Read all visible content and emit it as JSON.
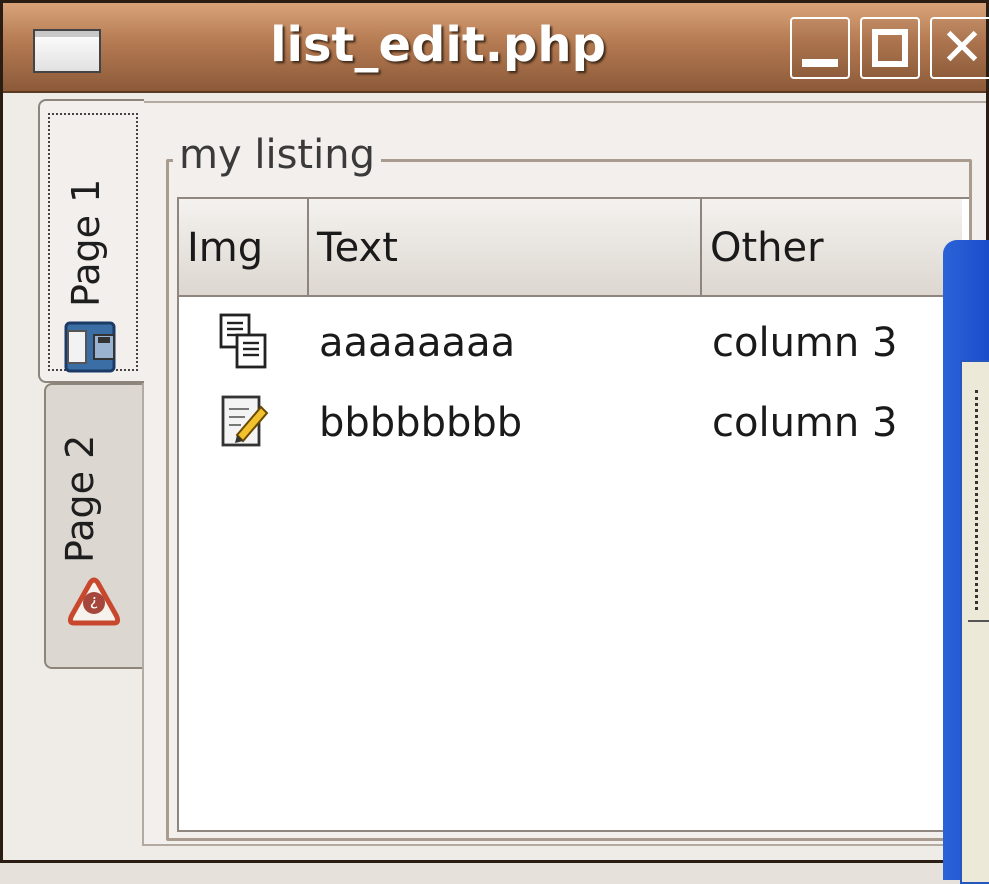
{
  "window": {
    "title": "list_edit.php",
    "colors": {
      "titlebar": "#b47a52",
      "overlap_window": "#1f55d0"
    }
  },
  "tabs": [
    {
      "label": "Page 1",
      "icon": "floppy-disk-icon",
      "selected": true
    },
    {
      "label": "Page 2",
      "icon": "help-icon",
      "selected": false
    }
  ],
  "group": {
    "legend": "my listing"
  },
  "list": {
    "columns": [
      "Img",
      "Text",
      "Other"
    ],
    "rows": [
      {
        "icon": "documents-icon",
        "text": "aaaaaaaa",
        "other": "column 3"
      },
      {
        "icon": "edit-document-icon",
        "text": "bbbbbbbb",
        "other": "column 3"
      }
    ]
  }
}
